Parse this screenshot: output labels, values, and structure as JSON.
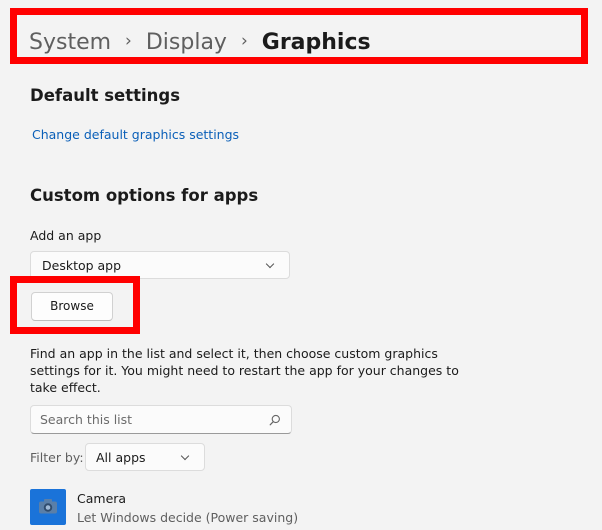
{
  "breadcrumb": {
    "items": [
      "System",
      "Display",
      "Graphics"
    ]
  },
  "default_settings": {
    "title": "Default settings",
    "link": "Change default graphics settings"
  },
  "custom_options": {
    "title": "Custom options for apps",
    "add_label": "Add an app",
    "app_type_selected": "Desktop app",
    "browse_label": "Browse",
    "description": "Find an app in the list and select it, then choose custom graphics settings for it. You might need to restart the app for your changes to take effect.",
    "search_placeholder": "Search this list",
    "filter_label": "Filter by:",
    "filter_selected": "All apps"
  },
  "apps": [
    {
      "name": "Camera",
      "setting": "Let Windows decide (Power saving)"
    }
  ],
  "icons": {
    "chevron": "chevron-down-icon",
    "search": "search-icon",
    "camera": "camera-icon",
    "breadcrumb_sep": "chevron-right-icon"
  },
  "colors": {
    "highlight": "#ff0000",
    "link": "#0a5fb8",
    "camera_tile": "#1a73d9"
  }
}
